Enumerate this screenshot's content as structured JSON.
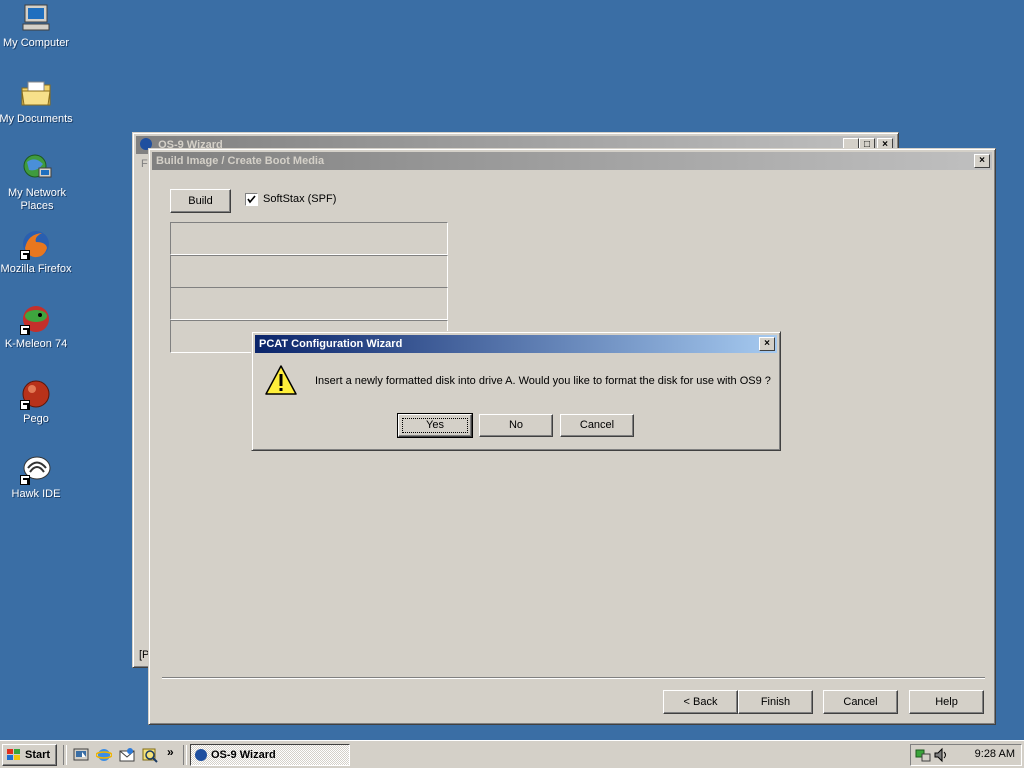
{
  "desktop": {
    "icons": [
      {
        "label": "My Computer"
      },
      {
        "label": "My Documents"
      },
      {
        "label": "My Network Places"
      },
      {
        "label": "Mozilla Firefox"
      },
      {
        "label": "K-Meleon 74"
      },
      {
        "label": "Pego"
      },
      {
        "label": "Hawk IDE"
      }
    ]
  },
  "os9_window": {
    "title": "OS-9 Wizard",
    "menu_hint": "F",
    "bottom_hint": "[P"
  },
  "build_window": {
    "title": "Build Image / Create Boot Media",
    "build_button": "Build",
    "softstax_checkbox": {
      "label": "SoftStax (SPF)",
      "checked": true
    },
    "footer_buttons": {
      "back": "< Back",
      "finish": "Finish",
      "cancel": "Cancel",
      "help": "Help"
    }
  },
  "dialog": {
    "title": "PCAT Configuration Wizard",
    "message": "Insert a newly formatted disk into drive A. Would you like to format the disk for use with OS9 ?",
    "icon": "warning-icon",
    "buttons": {
      "yes": "Yes",
      "no": "No",
      "cancel": "Cancel"
    }
  },
  "taskbar": {
    "start_label": "Start",
    "active_task": "OS-9 Wizard",
    "clock": "9:28 AM",
    "quick_launch_chevron": "»"
  },
  "colors": {
    "desktop": "#3a6ea5",
    "active_title": "#0a246a",
    "face": "#d4d0c8"
  }
}
